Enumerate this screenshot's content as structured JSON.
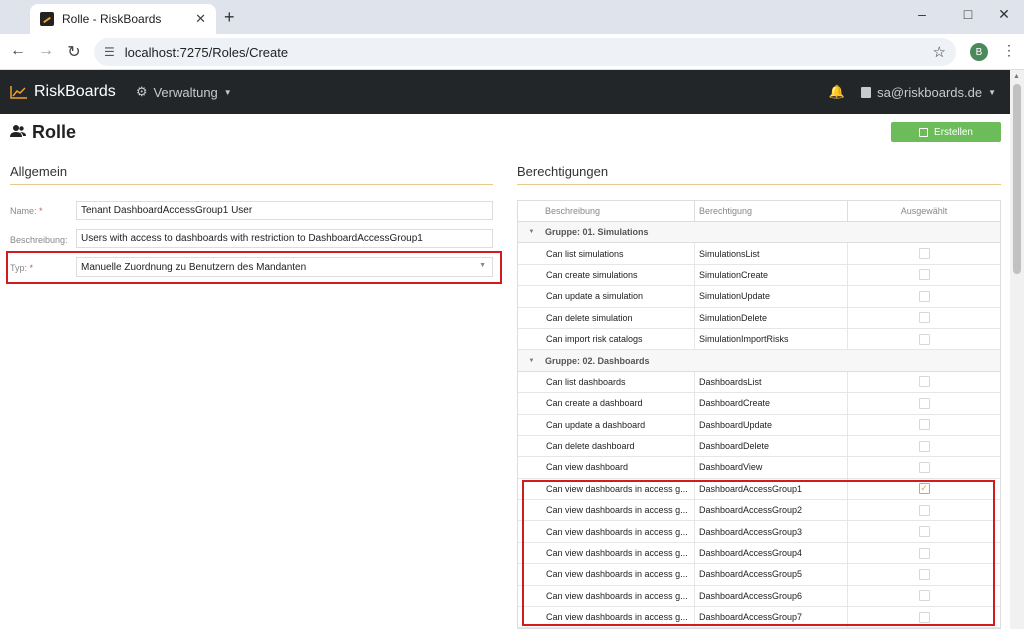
{
  "browser": {
    "tab_title": "Rolle - RiskBoards",
    "tab_close": "✕",
    "new_tab": "+",
    "url": "localhost:7275/Roles/Create",
    "profile_initial": "B",
    "icons": {
      "back": "arrow-left",
      "forward": "arrow-right",
      "reload": "reload",
      "site_info": "tune",
      "bookmark": "star",
      "menu": "kebab",
      "minimize": "minimize",
      "maximize": "maximize",
      "close": "close"
    }
  },
  "navbar": {
    "brand": "RiskBoards",
    "menu_label": "Verwaltung",
    "user": "sa@riskboards.de"
  },
  "page": {
    "title": "Rolle",
    "create_button": "Erstellen"
  },
  "general": {
    "section_title": "Allgemein",
    "name_label": "Name:",
    "name_value": "Tenant DashboardAccessGroup1 User",
    "description_label": "Beschreibung:",
    "description_value": "Users with access to dashboards with restriction to DashboardAccessGroup1",
    "type_label": "Typ:",
    "type_value": "Manuelle Zuordnung zu Benutzern des Mandanten",
    "required_mark": "*"
  },
  "permissions": {
    "section_title": "Berechtigungen",
    "columns": [
      "Beschreibung",
      "Berechtigung",
      "Ausgewählt"
    ],
    "groups": [
      {
        "label": "Gruppe: 01. Simulations",
        "rows": [
          {
            "description": "Can list simulations",
            "permission": "SimulationsList",
            "selected": false
          },
          {
            "description": "Can create simulations",
            "permission": "SimulationCreate",
            "selected": false
          },
          {
            "description": "Can update a simulation",
            "permission": "SimulationUpdate",
            "selected": false
          },
          {
            "description": "Can delete simulation",
            "permission": "SimulationDelete",
            "selected": false
          },
          {
            "description": "Can import risk catalogs",
            "permission": "SimulationImportRisks",
            "selected": false
          }
        ]
      },
      {
        "label": "Gruppe: 02. Dashboards",
        "rows": [
          {
            "description": "Can list dashboards",
            "permission": "DashboardsList",
            "selected": false
          },
          {
            "description": "Can create a dashboard",
            "permission": "DashboardCreate",
            "selected": false
          },
          {
            "description": "Can update a dashboard",
            "permission": "DashboardUpdate",
            "selected": false
          },
          {
            "description": "Can delete dashboard",
            "permission": "DashboardDelete",
            "selected": false
          },
          {
            "description": "Can view dashboard",
            "permission": "DashboardView",
            "selected": false
          },
          {
            "description": "Can view dashboards in access g...",
            "permission": "DashboardAccessGroup1",
            "selected": true
          },
          {
            "description": "Can view dashboards in access g...",
            "permission": "DashboardAccessGroup2",
            "selected": false
          },
          {
            "description": "Can view dashboards in access g...",
            "permission": "DashboardAccessGroup3",
            "selected": false
          },
          {
            "description": "Can view dashboards in access g...",
            "permission": "DashboardAccessGroup4",
            "selected": false
          },
          {
            "description": "Can view dashboards in access g...",
            "permission": "DashboardAccessGroup5",
            "selected": false
          },
          {
            "description": "Can view dashboards in access g...",
            "permission": "DashboardAccessGroup6",
            "selected": false
          },
          {
            "description": "Can view dashboards in access g...",
            "permission": "DashboardAccessGroup7",
            "selected": false
          }
        ]
      }
    ]
  },
  "colors": {
    "navbar": "#222629",
    "accent": "#f0a030",
    "create_button": "#6cbd5a",
    "highlight": "#d01c1c"
  }
}
